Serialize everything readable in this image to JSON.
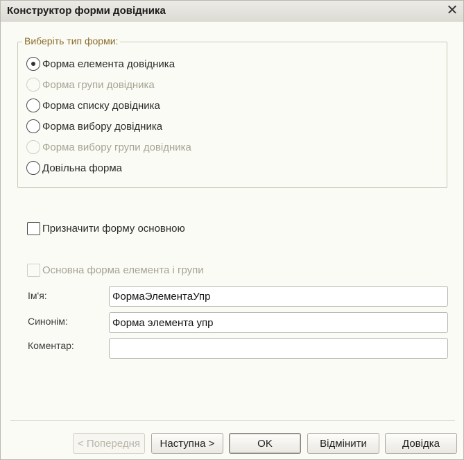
{
  "window": {
    "title": "Конструктор форми довідника",
    "close_glyph": "✕"
  },
  "form_type": {
    "legend": "Виберіть тип форми:",
    "options": [
      {
        "label": "Форма елемента довідника",
        "checked": true,
        "enabled": true
      },
      {
        "label": "Форма групи довідника",
        "checked": false,
        "enabled": false
      },
      {
        "label": "Форма списку довідника",
        "checked": false,
        "enabled": true
      },
      {
        "label": "Форма вибору довідника",
        "checked": false,
        "enabled": true
      },
      {
        "label": "Форма вибору групи довідника",
        "checked": false,
        "enabled": false
      },
      {
        "label": "Довільна форма",
        "checked": false,
        "enabled": true
      }
    ]
  },
  "checkboxes": {
    "set_main": {
      "label": "Призначити форму основною",
      "checked": false,
      "enabled": true
    },
    "main_element_group": {
      "label": "Основна форма елемента і групи",
      "checked": false,
      "enabled": false
    }
  },
  "fields": {
    "name": {
      "label": "Ім'я:",
      "value": "ФормаЭлементаУпр"
    },
    "synonym": {
      "label": "Синонім:",
      "value": "Форма элемента упр"
    },
    "comment": {
      "label": "Коментар:",
      "value": ""
    }
  },
  "buttons": {
    "prev": "< Попередня",
    "next": "Наступна >",
    "ok": "OK",
    "cancel": "Відмінити",
    "help": "Довідка"
  }
}
